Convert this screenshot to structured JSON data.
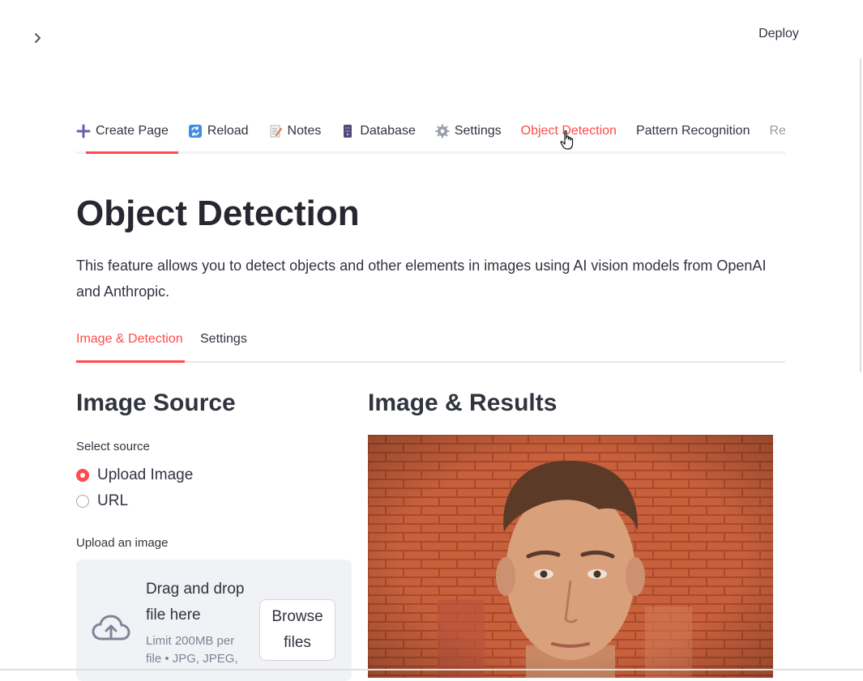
{
  "header": {
    "deploy_label": "Deploy"
  },
  "topnav": {
    "items": [
      {
        "label": "Create Page",
        "icon": "plus-icon"
      },
      {
        "label": "Reload",
        "icon": "reload-icon"
      },
      {
        "label": "Notes",
        "icon": "memo-icon"
      },
      {
        "label": "Database",
        "icon": "database-icon"
      },
      {
        "label": "Settings",
        "icon": "gear-icon"
      },
      {
        "label": "Object Detection",
        "icon": ""
      },
      {
        "label": "Pattern Recognition",
        "icon": ""
      },
      {
        "label": "Rea",
        "icon": ""
      }
    ],
    "active_color": "#ff4b4b"
  },
  "page": {
    "title": "Object Detection",
    "description": "This feature allows you to detect objects and other elements in images using AI vision models from OpenAI and Anthropic."
  },
  "tabs": [
    {
      "label": "Image & Detection",
      "selected": true
    },
    {
      "label": "Settings",
      "selected": false
    }
  ],
  "image_source": {
    "title": "Image Source",
    "select_label": "Select source",
    "options": [
      {
        "label": "Upload Image",
        "selected": true
      },
      {
        "label": "URL",
        "selected": false
      }
    ],
    "upload_label": "Upload an image",
    "dropzone_title": "Drag and drop file here",
    "dropzone_limit": "Limit 200MB per file • JPG, JPEG,",
    "browse_label": "Browse files"
  },
  "results": {
    "title": "Image & Results",
    "image": "portrait-photo"
  },
  "colors": {
    "accent": "#ff4b4b",
    "text": "#31333f",
    "dropzone_bg": "#f0f2f6"
  }
}
